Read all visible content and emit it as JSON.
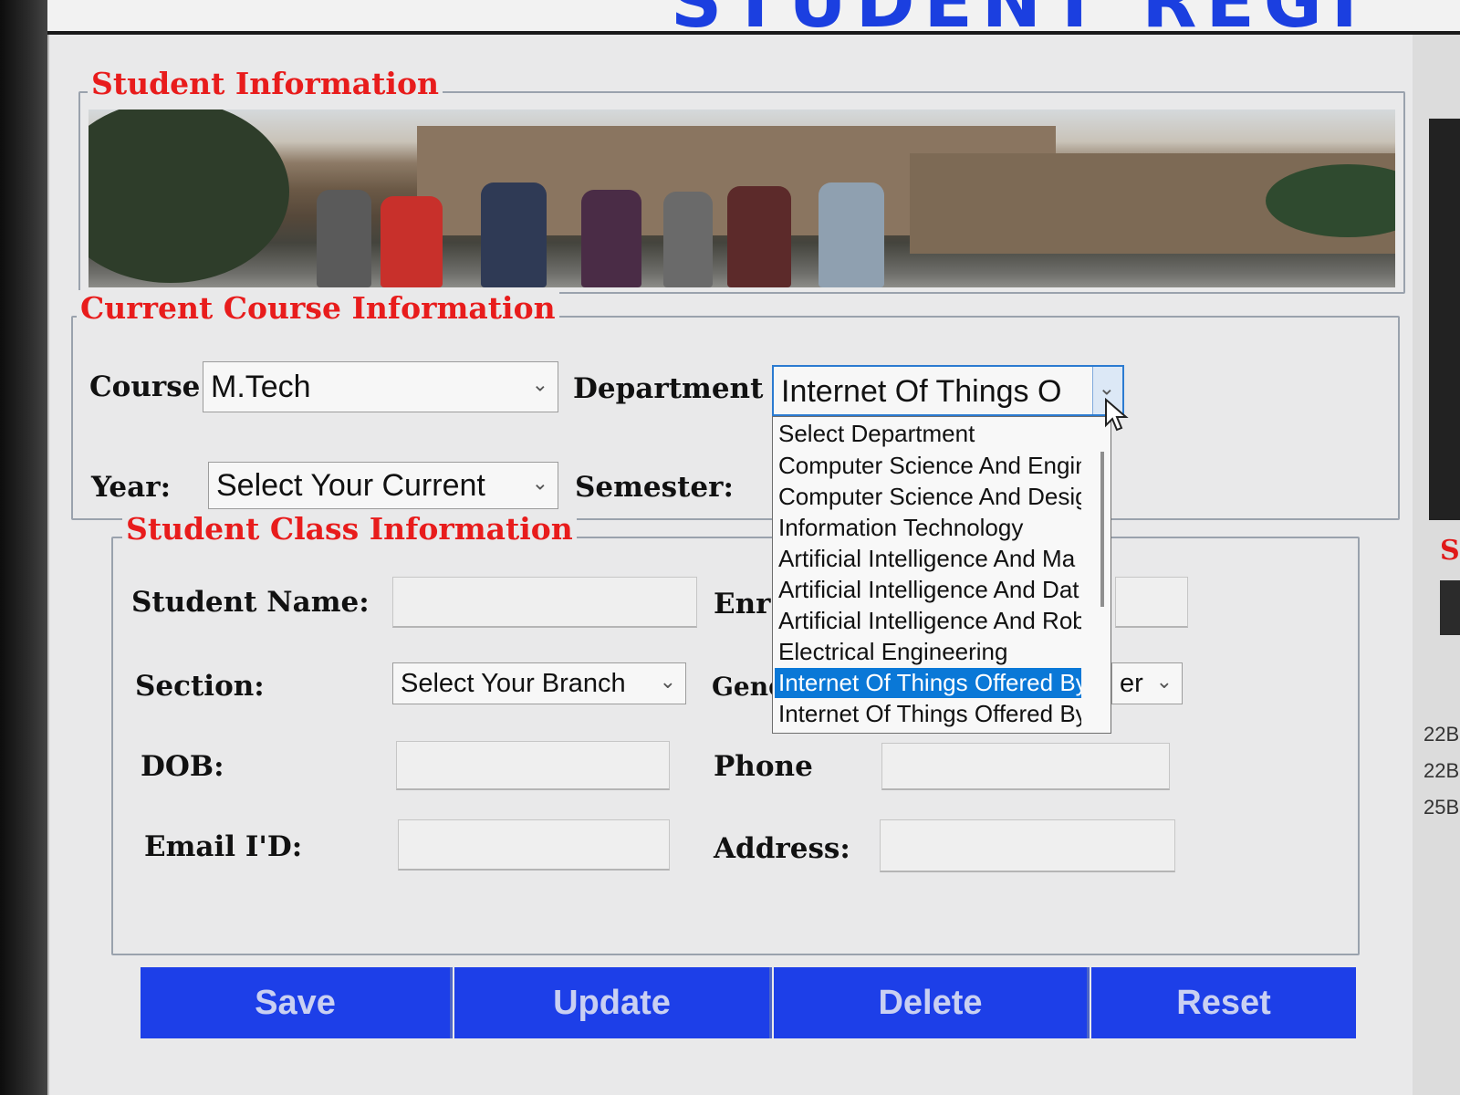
{
  "window": {
    "title": "STUDENT REGI"
  },
  "sections": {
    "student_info_title": "Student Information",
    "course_info_title": "Current Course Information",
    "class_info_title": "Student Class Information"
  },
  "course": {
    "course_label": "Course",
    "course_value": "M.Tech",
    "department_label": "Department",
    "department_value": "Internet Of Things O",
    "year_label": "Year:",
    "year_value": "Select Your Current",
    "semester_label": "Semester:"
  },
  "department_dropdown": {
    "options": [
      "Select Department",
      "Computer Science And Engin",
      "Computer Science And Desig",
      "Information Technology",
      "Artificial Intelligence And Ma",
      "Artificial Intelligence And Dat",
      "Artificial Intelligence And Rob",
      "Electrical Engineering",
      "Internet Of Things Offered By",
      "Internet Of Things Offered By"
    ],
    "selected_index": 8
  },
  "class_info": {
    "student_name_label": "Student Name:",
    "enrollment_label": "Enr",
    "section_label": "Section:",
    "section_value": "Select Your Branch",
    "gender_label": "Gend",
    "gender_value": "er",
    "dob_label": "DOB:",
    "phone_label": "Phone",
    "email_label": "Email I'D:",
    "address_label": "Address:"
  },
  "buttons": {
    "save": "Save",
    "update": "Update",
    "delete": "Delete",
    "reset": "Reset"
  },
  "right_panel": {
    "label": "S",
    "codes": [
      "22B",
      "22B",
      "25B"
    ]
  },
  "colors": {
    "section_title": "#e81c1c",
    "button_bg": "#1d3fe8",
    "selection": "#0a78d7",
    "title_blue": "#1b3fe0"
  }
}
